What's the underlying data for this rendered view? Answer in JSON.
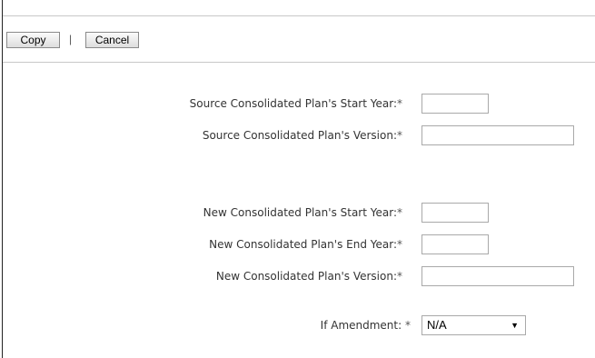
{
  "toolbar": {
    "copy_label": "Copy",
    "separator": "|",
    "cancel_label": "Cancel"
  },
  "form": {
    "source_start_year": {
      "label": "Source Consolidated Plan's Start Year:",
      "required_marker": "*",
      "value": ""
    },
    "source_version": {
      "label": "Source Consolidated Plan's Version:",
      "required_marker": "*",
      "value": ""
    },
    "new_start_year": {
      "label": "New Consolidated Plan's Start Year:",
      "required_marker": "*",
      "value": ""
    },
    "new_end_year": {
      "label": "New Consolidated Plan's End Year:",
      "required_marker": "*",
      "value": ""
    },
    "new_version": {
      "label": "New Consolidated Plan's Version:",
      "required_marker": "*",
      "value": ""
    },
    "amendment": {
      "label": "If Amendment:",
      "required_marker": "*",
      "selected": "N/A"
    }
  },
  "icons": {
    "dropdown": "chevron-down-icon"
  }
}
